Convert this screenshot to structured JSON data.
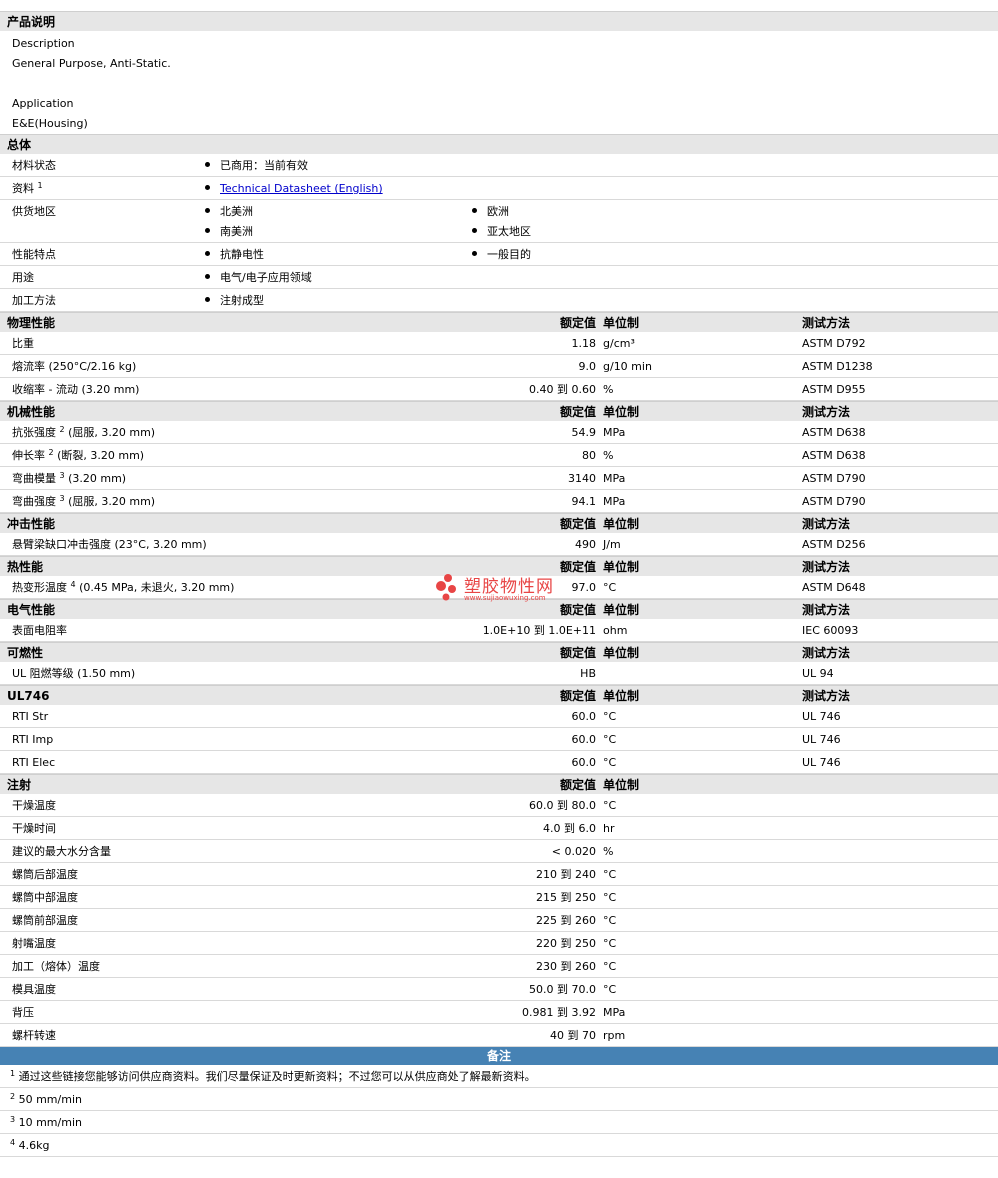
{
  "product": {
    "title": "产品说明",
    "description_label": "Description",
    "description_value": "General Purpose, Anti-Static.",
    "application_label": "Application",
    "application_value": "E&E(Housing)"
  },
  "general": {
    "title": "总体",
    "status_label": "材料状态",
    "status_value": "已商用：当前有效",
    "docs_label": "资料",
    "docs_sup": "1",
    "docs_link": "Technical Datasheet (English)",
    "supply_label": "供货地区",
    "supply_values": [
      "北美洲",
      "欧洲",
      "南美洲",
      "亚太地区"
    ],
    "features_label": "性能特点",
    "features_values": [
      "抗静电性",
      "一般目的"
    ],
    "uses_label": "用途",
    "uses_value": "电气/电子应用领域",
    "processing_label": "加工方法",
    "processing_value": "注射成型"
  },
  "headers": {
    "value": "额定值",
    "unit": "单位制",
    "method": "测试方法"
  },
  "physical": {
    "title": "物理性能",
    "rows": [
      {
        "name": "比重",
        "sup": "",
        "after": "",
        "value": "1.18",
        "unit": "g/cm³",
        "method": "ASTM D792"
      },
      {
        "name": "熔流率 (250°C/2.16 kg)",
        "sup": "",
        "after": "",
        "value": "9.0",
        "unit": "g/10 min",
        "method": "ASTM D1238"
      },
      {
        "name": "收缩率 - 流动 (3.20 mm)",
        "sup": "",
        "after": "",
        "value": "0.40 到 0.60",
        "unit": "%",
        "method": "ASTM D955"
      }
    ]
  },
  "mechanical": {
    "title": "机械性能",
    "rows": [
      {
        "name": "抗张强度",
        "sup": "2",
        "after": "(屈服, 3.20 mm)",
        "value": "54.9",
        "unit": "MPa",
        "method": "ASTM D638"
      },
      {
        "name": "伸长率",
        "sup": "2",
        "after": "(断裂, 3.20 mm)",
        "value": "80",
        "unit": "%",
        "method": "ASTM D638"
      },
      {
        "name": "弯曲模量",
        "sup": "3",
        "after": "(3.20 mm)",
        "value": "3140",
        "unit": "MPa",
        "method": "ASTM D790"
      },
      {
        "name": "弯曲强度",
        "sup": "3",
        "after": "(屈服, 3.20 mm)",
        "value": "94.1",
        "unit": "MPa",
        "method": "ASTM D790"
      }
    ]
  },
  "impact": {
    "title": "冲击性能",
    "rows": [
      {
        "name": "悬臂梁缺口冲击强度 (23°C, 3.20 mm)",
        "sup": "",
        "after": "",
        "value": "490",
        "unit": "J/m",
        "method": "ASTM D256"
      }
    ]
  },
  "thermal": {
    "title": "热性能",
    "rows": [
      {
        "name": "热变形温度",
        "sup": "4",
        "after": "(0.45 MPa, 未退火, 3.20 mm)",
        "value": "97.0",
        "unit": "°C",
        "method": "ASTM D648"
      }
    ]
  },
  "electrical": {
    "title": "电气性能",
    "rows": [
      {
        "name": "表面电阻率",
        "sup": "",
        "after": "",
        "value": "1.0E+10 到 1.0E+11",
        "unit": "ohm",
        "method": "IEC 60093"
      }
    ]
  },
  "flammability": {
    "title": "可燃性",
    "rows": [
      {
        "name": "UL 阻燃等级 (1.50 mm)",
        "sup": "",
        "after": "",
        "value": "HB",
        "unit": "",
        "method": "UL 94"
      }
    ]
  },
  "ul746": {
    "title": "UL746",
    "rows": [
      {
        "name": "RTI Str",
        "sup": "",
        "after": "",
        "value": "60.0",
        "unit": "°C",
        "method": "UL 746"
      },
      {
        "name": "RTI Imp",
        "sup": "",
        "after": "",
        "value": "60.0",
        "unit": "°C",
        "method": "UL 746"
      },
      {
        "name": "RTI Elec",
        "sup": "",
        "after": "",
        "value": "60.0",
        "unit": "°C",
        "method": "UL 746"
      }
    ]
  },
  "injection": {
    "title": "注射",
    "rows": [
      {
        "name": "干燥温度",
        "sup": "",
        "after": "",
        "value": "60.0 到 80.0",
        "unit": "°C",
        "method": ""
      },
      {
        "name": "干燥时间",
        "sup": "",
        "after": "",
        "value": "4.0 到 6.0",
        "unit": "hr",
        "method": ""
      },
      {
        "name": "建议的最大水分含量",
        "sup": "",
        "after": "",
        "value": "< 0.020",
        "unit": "%",
        "method": ""
      },
      {
        "name": "螺筒后部温度",
        "sup": "",
        "after": "",
        "value": "210 到 240",
        "unit": "°C",
        "method": ""
      },
      {
        "name": "螺筒中部温度",
        "sup": "",
        "after": "",
        "value": "215 到 250",
        "unit": "°C",
        "method": ""
      },
      {
        "name": "螺筒前部温度",
        "sup": "",
        "after": "",
        "value": "225 到 260",
        "unit": "°C",
        "method": ""
      },
      {
        "name": "射嘴温度",
        "sup": "",
        "after": "",
        "value": "220 到 250",
        "unit": "°C",
        "method": ""
      },
      {
        "name": "加工（熔体）温度",
        "sup": "",
        "after": "",
        "value": "230 到 260",
        "unit": "°C",
        "method": ""
      },
      {
        "name": "模具温度",
        "sup": "",
        "after": "",
        "value": "50.0 到 70.0",
        "unit": "°C",
        "method": ""
      },
      {
        "name": "背压",
        "sup": "",
        "after": "",
        "value": "0.981 到 3.92",
        "unit": "MPa",
        "method": ""
      },
      {
        "name": "螺杆转速",
        "sup": "",
        "after": "",
        "value": "40 到 70",
        "unit": "rpm",
        "method": ""
      }
    ]
  },
  "notes": {
    "title": "备注",
    "items": [
      {
        "sup": "1",
        "text": "通过这些链接您能够访问供应商资料。我们尽量保证及时更新资料；不过您可以从供应商处了解最新资料。"
      },
      {
        "sup": "2",
        "text": "50 mm/min"
      },
      {
        "sup": "3",
        "text": "10 mm/min"
      },
      {
        "sup": "4",
        "text": "4.6kg"
      }
    ]
  },
  "watermark": {
    "title": "塑胶物性网",
    "url": "www.sujiaowuxing.com"
  }
}
